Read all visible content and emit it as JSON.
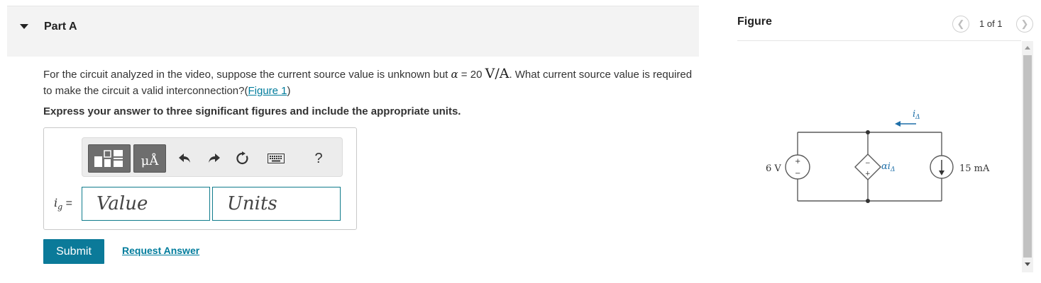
{
  "part": {
    "title": "Part A"
  },
  "question": {
    "text_1": "For the circuit analyzed in the video, suppose the current source value is unknown but ",
    "alpha_symbol": "α",
    "equals": " = 20 ",
    "unit": "V/A",
    "text_2": ". What current source value is required to make the circuit a valid interconnection?",
    "figure_link": "Figure 1",
    "link_open": "(",
    "link_close": ")",
    "instruction": "Express your answer to three significant figures and include the appropriate units."
  },
  "toolbar": {
    "templates_icon": "templates-icon",
    "units_label": "μÅ",
    "undo_icon": "undo-icon",
    "redo_icon": "redo-icon",
    "reset_icon": "reset-icon",
    "keyboard_icon": "keyboard-icon",
    "help_label": "?"
  },
  "answer": {
    "var_symbol": "i",
    "var_subscript": "g",
    "equals": " =",
    "value_placeholder": "Value",
    "units_placeholder": "Units"
  },
  "actions": {
    "submit_label": "Submit",
    "request_label": "Request Answer"
  },
  "figure": {
    "title": "Figure",
    "pager_label": "1 of 1",
    "prev_icon": "chevron-left-icon",
    "next_icon": "chevron-right-icon",
    "circuit": {
      "voltage_label": "6 V",
      "current_label": "15 mA",
      "dependent_source_label": "αi",
      "dependent_subscript": "Δ",
      "current_arrow_label": "i",
      "current_arrow_subscript": "Δ",
      "plus_sign": "+",
      "minus_sign": "−"
    }
  },
  "colors": {
    "accent": "#0b7a99",
    "link": "#007c9c",
    "field_border": "#107c8c",
    "header_bg": "#f3f3f3",
    "arrow_blue": "#1f6fa8"
  }
}
